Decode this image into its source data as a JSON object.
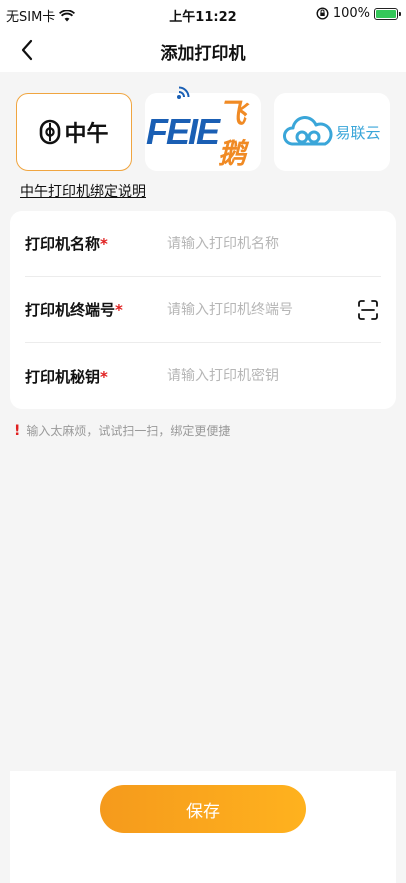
{
  "status_bar": {
    "carrier": "无SIM卡",
    "time": "上午11:22",
    "battery": "100%"
  },
  "nav": {
    "title": "添加打印机",
    "back_icon": "chevron-left-icon"
  },
  "brands": [
    {
      "id": "zhongwu",
      "label": "中午",
      "selected": true
    },
    {
      "id": "feie",
      "label_en": "FEIE",
      "label_cn": "飞鹅",
      "selected": false
    },
    {
      "id": "yilianyun",
      "label": "易联云",
      "selected": false
    }
  ],
  "bind_guide": "中午打印机绑定说明",
  "form": {
    "fields": [
      {
        "label": "打印机名称",
        "required": "*",
        "placeholder": "请输入打印机名称",
        "value": ""
      },
      {
        "label": "打印机终端号",
        "required": "*",
        "placeholder": "请输入打印机终端号",
        "value": ""
      },
      {
        "label": "打印机秘钥",
        "required": "*",
        "placeholder": "请输入打印机密钥",
        "value": ""
      }
    ],
    "scan_icon": "scan-icon"
  },
  "tip": {
    "mark": "!",
    "text": "输入太麻烦，试试扫一扫，绑定更便捷"
  },
  "footer": {
    "save_label": "保存"
  },
  "colors": {
    "accent": "#f59a1c",
    "selected_border": "#f0a540",
    "required": "#e02020"
  }
}
